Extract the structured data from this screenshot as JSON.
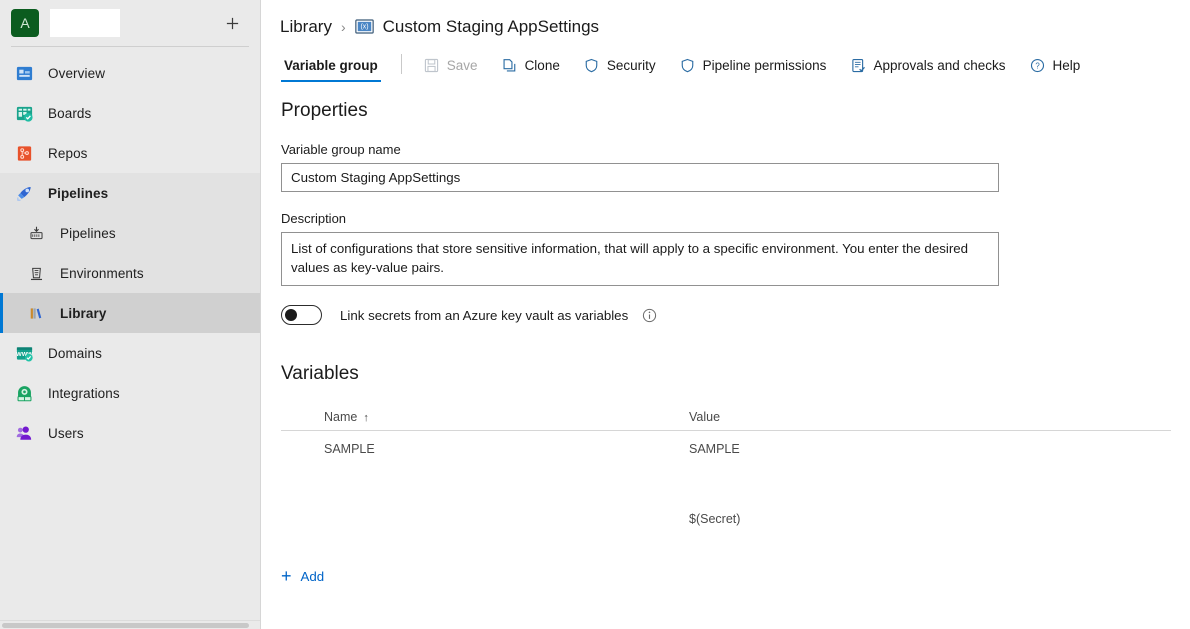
{
  "sidebar": {
    "org": {
      "avatar_letter": "A",
      "name": "",
      "add_button": "+"
    },
    "items": [
      {
        "label": "Overview",
        "icon": "overview-icon",
        "state": "normal"
      },
      {
        "label": "Boards",
        "icon": "boards-icon",
        "state": "normal"
      },
      {
        "label": "Repos",
        "icon": "repos-icon",
        "state": "normal"
      },
      {
        "label": "Pipelines",
        "icon": "pipelines-rocket-icon",
        "state": "group-head"
      },
      {
        "label": "Pipelines",
        "icon": "pipelines-sub-icon",
        "state": "sub"
      },
      {
        "label": "Environments",
        "icon": "environments-icon",
        "state": "sub"
      },
      {
        "label": "Library",
        "icon": "library-books-icon",
        "state": "selected"
      },
      {
        "label": "Domains",
        "icon": "domains-www-icon",
        "state": "normal"
      },
      {
        "label": "Integrations",
        "icon": "integrations-icon",
        "state": "normal"
      },
      {
        "label": "Users",
        "icon": "users-icon",
        "state": "normal"
      }
    ]
  },
  "breadcrumb": {
    "parent": "Library",
    "separator": "›",
    "current_icon": "variable-group-icon",
    "current": "Custom Staging AppSettings"
  },
  "toolbar": {
    "tab_label": "Variable group",
    "buttons": [
      {
        "label": "Save",
        "icon": "save-icon",
        "disabled": true
      },
      {
        "label": "Clone",
        "icon": "clone-icon",
        "disabled": false
      },
      {
        "label": "Security",
        "icon": "shield-icon",
        "disabled": false
      },
      {
        "label": "Pipeline permissions",
        "icon": "shield-icon",
        "disabled": false
      },
      {
        "label": "Approvals and checks",
        "icon": "approvals-checklist-icon",
        "disabled": false
      },
      {
        "label": "Help",
        "icon": "help-circle-icon",
        "disabled": false
      }
    ]
  },
  "properties": {
    "title": "Properties",
    "name_label": "Variable group name",
    "name_value": "Custom Staging AppSettings",
    "name_placeholder": "",
    "description_label": "Description",
    "description_value": "List of configurations that store sensitive information, that will apply to a specific environment. You enter the desired values as key-value pairs.",
    "description_placeholder": "",
    "keyvault_toggle_label": "Link secrets from an Azure key vault as variables",
    "keyvault_toggle_state": "off",
    "info_icon": "info-icon"
  },
  "variables": {
    "title": "Variables",
    "columns": {
      "name": "Name",
      "name_sort": "↑",
      "value": "Value",
      "lock_icon": "lock-icon"
    },
    "rows": [
      {
        "name": "SAMPLE",
        "value": "SAMPLE"
      },
      {
        "name": "",
        "value": "$(Secret)"
      }
    ],
    "add_label": "Add",
    "add_icon": "plus-icon"
  },
  "colors": {
    "accent": "#0078d4",
    "link": "#0064c8",
    "sidebar_bg": "#eaeaea",
    "selected_bg": "#d0d0d0",
    "avatar_bg": "#0b5c1f"
  }
}
